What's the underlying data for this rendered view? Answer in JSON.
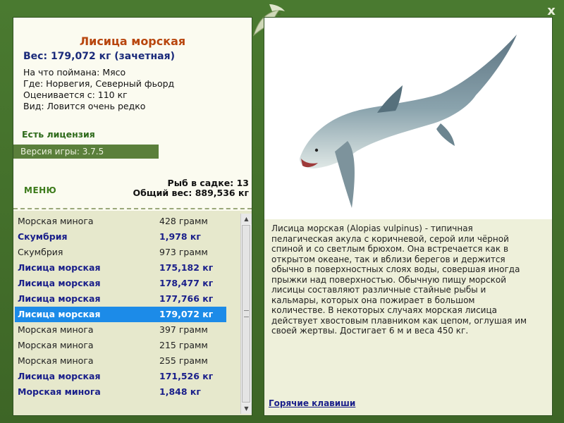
{
  "fish": {
    "title": "Лисица морская",
    "weight": "Вес: 179,072 кг (зачетная)",
    "bait": "На что поймана: Мясо",
    "location": "Где: Норвегия, Северный фьорд",
    "value": "Оценивается с: 110 кг",
    "rarity": "Вид: Ловится очень редко"
  },
  "license": "Есть лицензия",
  "version": "Версия игры: 3.7.5",
  "menu_label": "МЕНЮ",
  "stats": {
    "count": "Рыб в садке: 13",
    "total": "Общий вес: 889,536 кг"
  },
  "catch_list": [
    {
      "name": "Морская минога",
      "weight": "428 грамм",
      "style": "normal"
    },
    {
      "name": "Скумбрия",
      "weight": "1,978 кг",
      "style": "bold"
    },
    {
      "name": "Скумбрия",
      "weight": "973 грамм",
      "style": "normal"
    },
    {
      "name": "Лисица морская",
      "weight": "175,182 кг",
      "style": "bold"
    },
    {
      "name": "Лисица морская",
      "weight": "178,477 кг",
      "style": "bold"
    },
    {
      "name": "Лисица морская",
      "weight": "177,766 кг",
      "style": "bold"
    },
    {
      "name": "Лисица морская",
      "weight": "179,072 кг",
      "style": "selected"
    },
    {
      "name": "Морская минога",
      "weight": "397 грамм",
      "style": "normal"
    },
    {
      "name": "Морская минога",
      "weight": "215 грамм",
      "style": "normal"
    },
    {
      "name": "Морская минога",
      "weight": "255 грамм",
      "style": "normal"
    },
    {
      "name": "Лисица морская",
      "weight": "171,526 кг",
      "style": "bold"
    },
    {
      "name": "Морская минога",
      "weight": "1,848 кг",
      "style": "bold"
    }
  ],
  "description": "Лисица морская (Alopias vulpinus) - типичная пелагическая акула с коричневой, серой или чёрной спиной и со светлым брюхом. Она встречается как в открытом океане, так и вблизи берегов и держится обычно в поверхностных слоях воды, совершая иногда прыжки над поверхностью. Обычную пищу морской лисицы составляют различные стайные рыбы и кальмары, которых она пожирает в большом количестве. В некоторых случаях морская лисица действует хвостовым плавником как цепом, оглушая им своей жертвы. Достигает 6 м и веса 450 кг.",
  "hotkeys_label": "Горячие клавиши",
  "close_label": "x",
  "colors": {
    "frame": "#3d6526",
    "title": "#b8460e",
    "bold_text": "#1a1f8a",
    "selection": "#1c8be8",
    "version_bar": "#5a7f3b"
  },
  "icons": [
    "fish-emblem-icon",
    "close-icon",
    "thresher-shark-image"
  ]
}
